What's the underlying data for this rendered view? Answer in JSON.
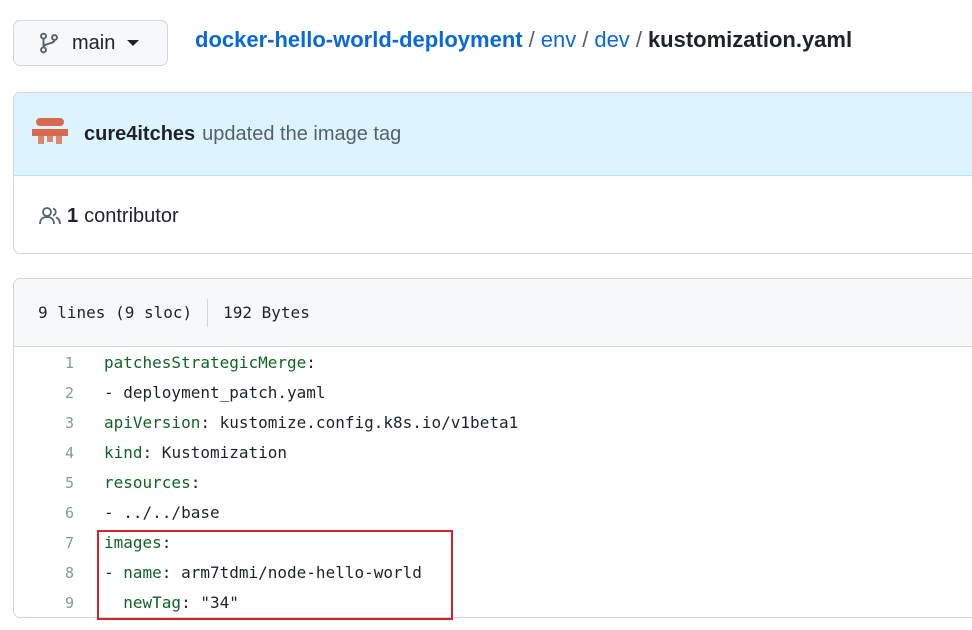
{
  "branch": {
    "name": "main"
  },
  "breadcrumb": {
    "repo": "docker-hello-world-deployment",
    "dir1": "env",
    "dir2": "dev",
    "file": "kustomization.yaml",
    "separator": "/"
  },
  "commit": {
    "author": "cure4itches",
    "message": "updated the image tag"
  },
  "contributors": {
    "count": "1",
    "label": "contributor"
  },
  "file_info": {
    "lines": "9 lines (9 sloc)",
    "size": "192 Bytes"
  },
  "code": [
    {
      "n": "1",
      "key": "patchesStrategicMerge",
      "colon": ":",
      "value": ""
    },
    {
      "n": "2",
      "key": "",
      "colon": "",
      "value": "- deployment_patch.yaml"
    },
    {
      "n": "3",
      "key": "apiVersion",
      "colon": ":",
      "value": " kustomize.config.k8s.io/v1beta1"
    },
    {
      "n": "4",
      "key": "kind",
      "colon": ":",
      "value": " Kustomization"
    },
    {
      "n": "5",
      "key": "resources",
      "colon": ":",
      "value": ""
    },
    {
      "n": "6",
      "key": "",
      "colon": "",
      "value": "- ../../base"
    },
    {
      "n": "7",
      "key": "images",
      "colon": ":",
      "value": ""
    },
    {
      "n": "8",
      "prefix": "- ",
      "key": "name",
      "colon": ":",
      "value": " arm7tdmi/node-hello-world"
    },
    {
      "n": "9",
      "prefix": "  ",
      "key": "newTag",
      "colon": ":",
      "value": " \"34\""
    }
  ],
  "colors": {
    "link": "#0969da",
    "yaml_key": "#116329",
    "annotation": "#d1242f",
    "commit_bg": "#ddf4ff"
  }
}
